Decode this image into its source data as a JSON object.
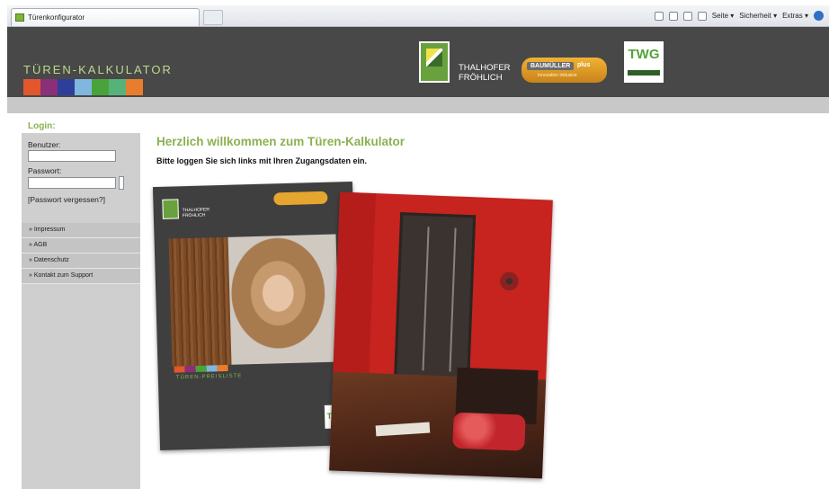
{
  "browser": {
    "tab_title": "Türenkonfigurator",
    "tools": [
      "Seite ▾",
      "Sicherheit ▾",
      "Extras ▾"
    ]
  },
  "header": {
    "title": "TÜREN-KALKULATOR",
    "swatch_colors": [
      "#e2572b",
      "#8a2f78",
      "#2e3f9b",
      "#7fb7de",
      "#4aa33a",
      "#55b37a",
      "#e87d2d"
    ],
    "logos": {
      "thalhofer": "THALHOFER\nFRÖHLICH",
      "baumueller": "BAUMÜLLER",
      "baumueller_plus": "plus",
      "baumueller_tagline": "Innovation inklusive",
      "twg": "TWG"
    }
  },
  "sidebar": {
    "login_title": "Login:",
    "user_label": "Benutzer:",
    "user_value": "",
    "password_label": "Passwort:",
    "password_value": "",
    "forgot_link": "[Passwort vergessen?]",
    "menu": [
      {
        "label": "» Impressum"
      },
      {
        "label": "» AGB"
      },
      {
        "label": "» Datenschutz"
      },
      {
        "label": "» Kontakt zum Support"
      }
    ]
  },
  "main": {
    "welcome": "Herzlich willkommen zum Türen-Kalkulator",
    "instruction": "Bitte loggen Sie sich links mit Ihren Zugangsdaten ein.",
    "brochure": {
      "thf_text": "THALHOFER\nFRÖHLICH",
      "label": "TÜREN-PREISLISTE",
      "twg": "TWG",
      "strip_colors": [
        "#e2572b",
        "#8a2f78",
        "#4aa33a",
        "#7fb7de",
        "#e87d2d"
      ]
    }
  }
}
